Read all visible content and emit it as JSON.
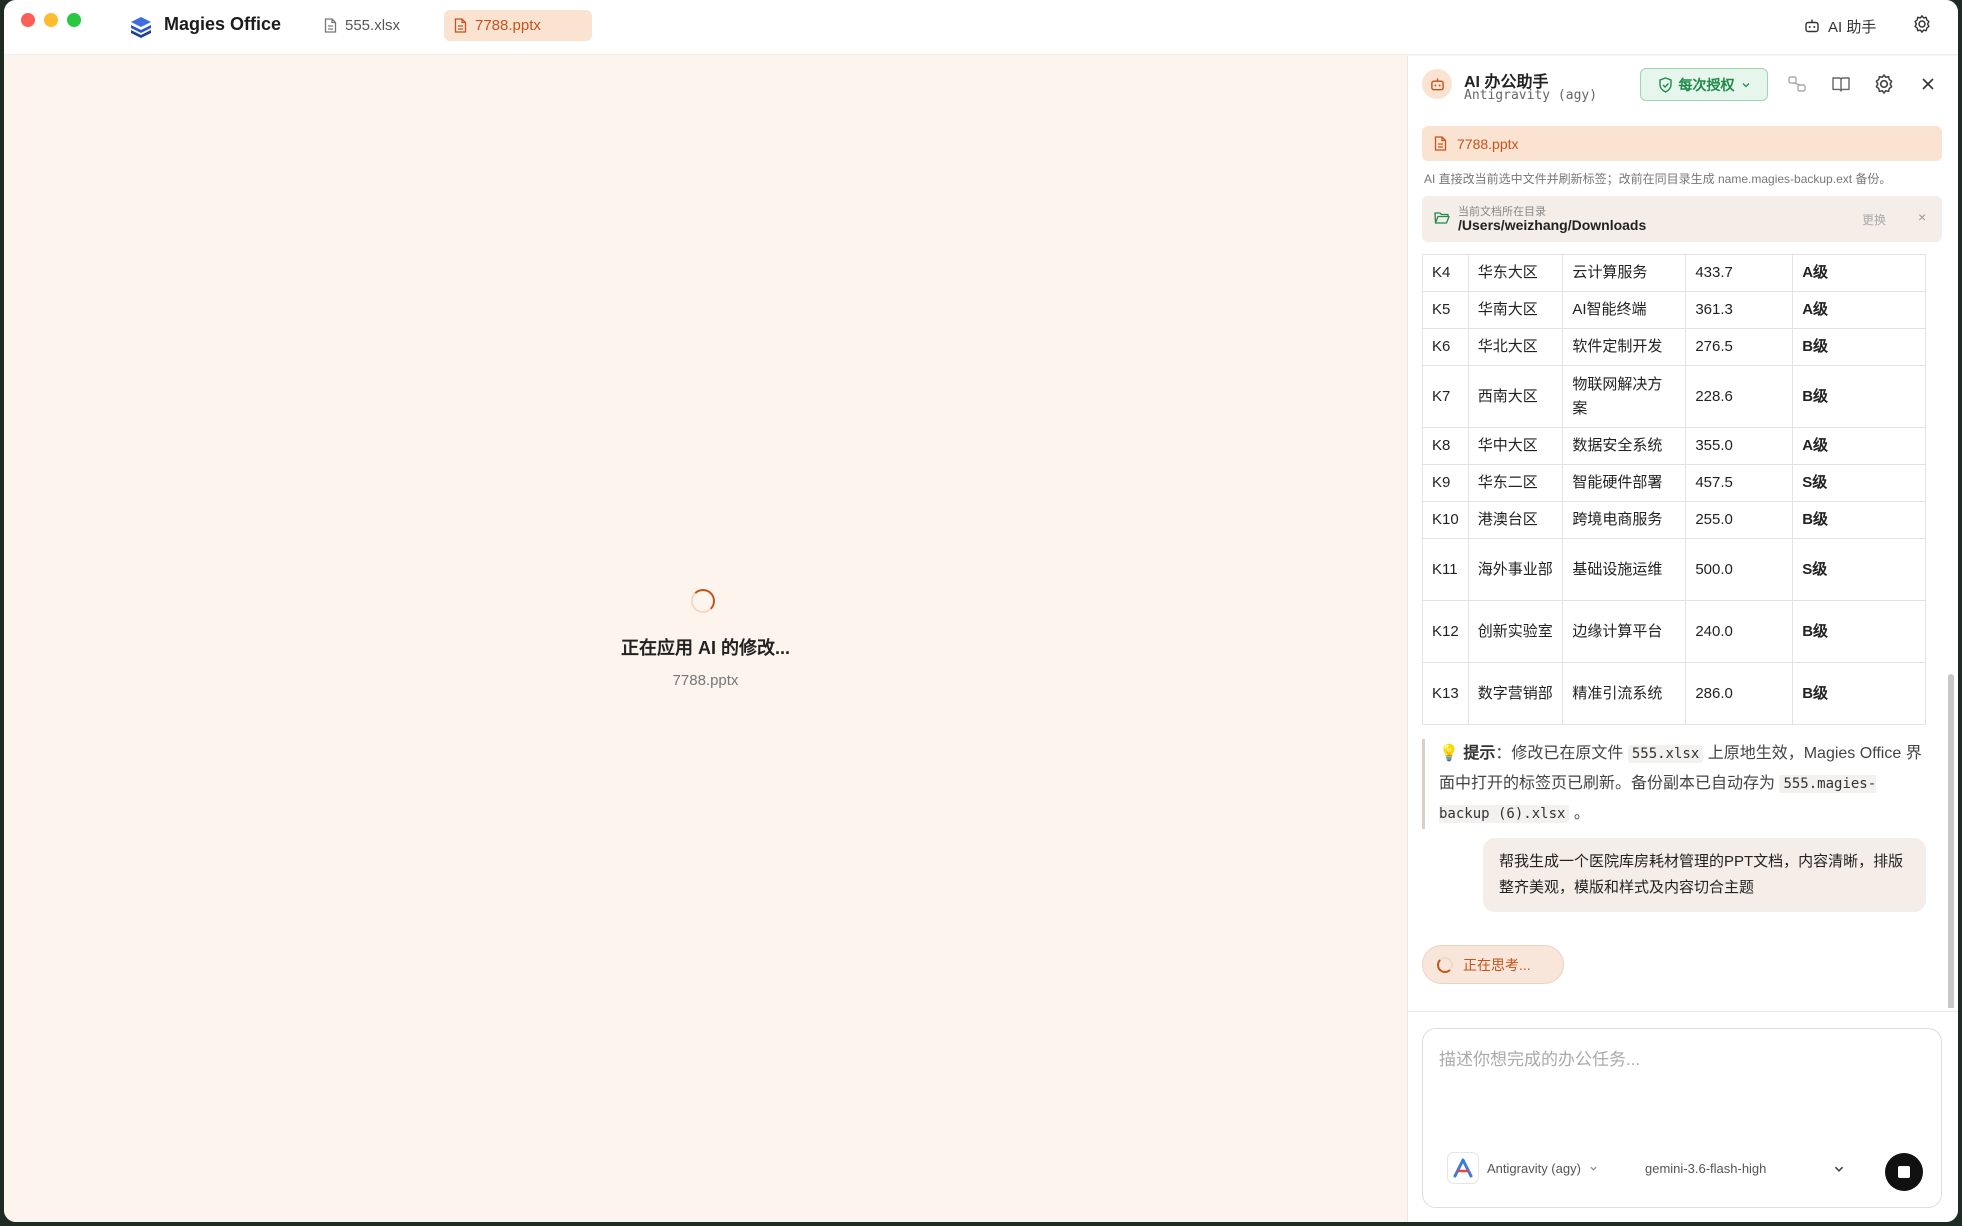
{
  "app": {
    "name": "Magies Office"
  },
  "tabs": [
    {
      "label": "555.xlsx",
      "active": false
    },
    {
      "label": "7788.pptx",
      "active": true
    }
  ],
  "titlebar": {
    "ai_label": "AI 助手"
  },
  "main": {
    "loading_text": "正在应用 AI 的修改...",
    "loading_file": "7788.pptx"
  },
  "panel": {
    "title": "AI 办公助手",
    "subtitle": "Antigravity (agy)",
    "auth_label": "每次授权",
    "file_banner": "7788.pptx",
    "note": "AI 直接改当前选中文件并刷新标签；改前在同目录生成 name.magies-backup.ext 备份。",
    "dir": {
      "label": "当前文档所在目录",
      "path": "/Users/weizhang/Downloads",
      "change": "更换",
      "close": "×"
    },
    "table_rows": [
      {
        "id": "K4",
        "region": "华东大区",
        "product": "云计算服务",
        "value": "433.7",
        "grade": "A级"
      },
      {
        "id": "K5",
        "region": "华南大区",
        "product": "AI智能终端",
        "value": "361.3",
        "grade": "A级"
      },
      {
        "id": "K6",
        "region": "华北大区",
        "product": "软件定制开发",
        "value": "276.5",
        "grade": "B级"
      },
      {
        "id": "K7",
        "region": "西南大区",
        "product": "物联网解决方案",
        "value": "228.6",
        "grade": "B级"
      },
      {
        "id": "K8",
        "region": "华中大区",
        "product": "数据安全系统",
        "value": "355.0",
        "grade": "A级"
      },
      {
        "id": "K9",
        "region": "华东二区",
        "product": "智能硬件部署",
        "value": "457.5",
        "grade": "S级"
      },
      {
        "id": "K10",
        "region": "港澳台区",
        "product": "跨境电商服务",
        "value": "255.0",
        "grade": "B级"
      },
      {
        "id": "K11",
        "region": "海外事业部",
        "product": "基础设施运维",
        "value": "500.0",
        "grade": "S级"
      },
      {
        "id": "K12",
        "region": "创新实验室",
        "product": "边缘计算平台",
        "value": "240.0",
        "grade": "B级"
      },
      {
        "id": "K13",
        "region": "数字营销部",
        "product": "精准引流系统",
        "value": "286.0",
        "grade": "B级"
      }
    ],
    "tip": {
      "emoji": "💡",
      "label": "提示",
      "text1": "：修改已在原文件 ",
      "file": "555.xlsx",
      "text2": " 上原地生效，Magies Office 界面中打开的标签页已刷新。备份副本已自动存为 ",
      "backup": "555.magies-backup (6).xlsx",
      "text3": " 。"
    },
    "user_message": "帮我生成一个医院库房耗材管理的PPT文档，内容清晰，排版整齐美观，模版和样式及内容切合主题",
    "thinking": "正在思考...",
    "input": {
      "placeholder": "描述你想完成的办公任务...",
      "agent": "Antigravity (agy)",
      "model": "gemini-3.6-flash-high"
    }
  },
  "colors": {
    "accent": "#c5531b",
    "accent_bg": "#fbe3d2",
    "canvas": "#fdf4ee",
    "auth_green": "#1f8a4c"
  }
}
